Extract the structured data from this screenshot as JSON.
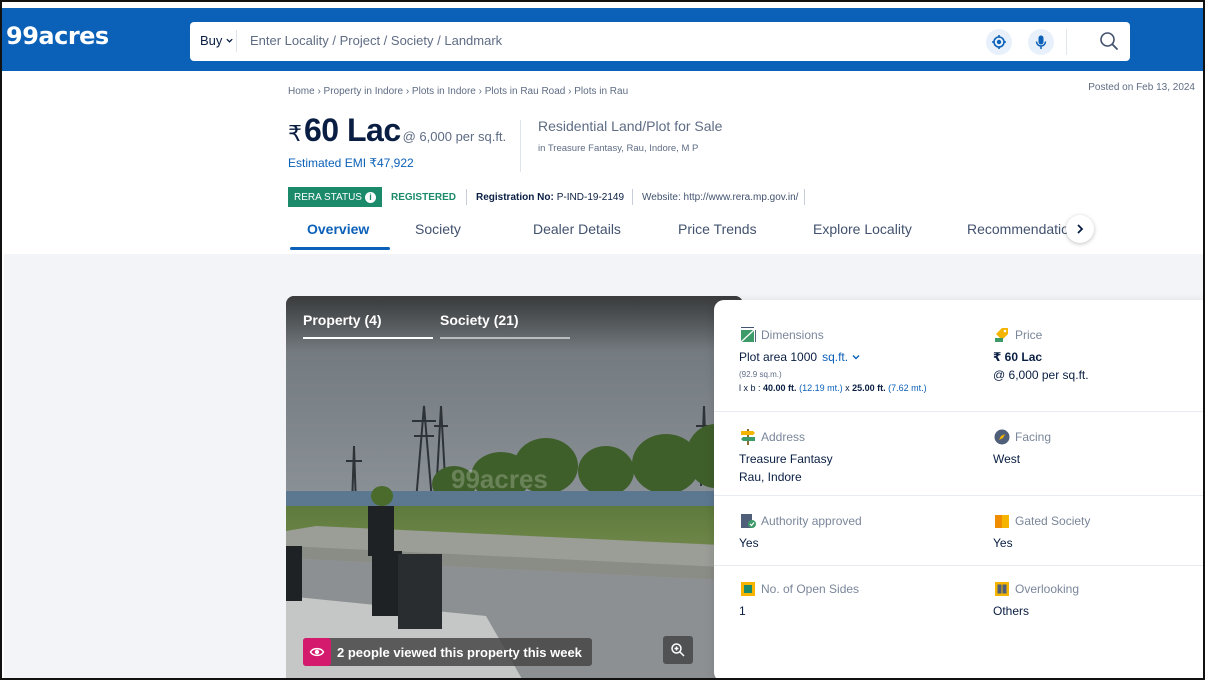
{
  "header": {
    "logo": "99acres",
    "buy_label": "Buy",
    "search_placeholder": "Enter Locality / Project / Society / Landmark"
  },
  "breadcrumb": "Home › Property in Indore › Plots in Indore › Plots in Rau Road › Plots in Rau",
  "posted": "Posted on Feb 13, 2024",
  "price": {
    "currency": "₹",
    "amount": "60 Lac",
    "rate": "@ 6,000 per sq.ft.",
    "emi": "Estimated EMI ₹47,922"
  },
  "property": {
    "type": "Residential Land/Plot for Sale",
    "address": "in Treasure Fantasy, Rau, Indore, M P"
  },
  "rera": {
    "status_label": "RERA STATUS",
    "status_value": "REGISTERED",
    "reg_label": "Registration No:",
    "reg_value": "P-IND-19-2149",
    "website": "Website: http://www.rera.mp.gov.in/"
  },
  "tabs": [
    "Overview",
    "Society",
    "Dealer Details",
    "Price Trends",
    "Explore Locality",
    "Recommendatio"
  ],
  "gallery": {
    "tab_property": "Property (4)",
    "tab_society": "Society (21)",
    "viewed": "2 people viewed this property this week",
    "watermark": "99acres"
  },
  "details": {
    "dimensions": {
      "label": "Dimensions",
      "plot_area": "Plot area 1000",
      "unit": "sq.ft.",
      "sqm": "(92.9 sq.m.)",
      "lxb_label": "l x b :",
      "length": "40.00 ft.",
      "length_m": "(12.19 mt.)",
      "x": "x",
      "breadth": "25.00 ft.",
      "breadth_m": "(7.62 mt.)"
    },
    "price": {
      "label": "Price",
      "value": "₹ 60 Lac",
      "rate": "@ 6,000 per sq.ft."
    },
    "address": {
      "label": "Address",
      "line1": "Treasure Fantasy",
      "line2": "Rau, Indore"
    },
    "facing": {
      "label": "Facing",
      "value": "West"
    },
    "authority": {
      "label": "Authority approved",
      "value": "Yes"
    },
    "gated": {
      "label": "Gated Society",
      "value": "Yes"
    },
    "open_sides": {
      "label": "No. of Open Sides",
      "value": "1"
    },
    "overlooking": {
      "label": "Overlooking",
      "value": "Others"
    }
  },
  "colors": {
    "brand_blue": "#0b60b8",
    "rera_green": "#1b8a6b",
    "viewed_pink": "#d31a6d"
  }
}
